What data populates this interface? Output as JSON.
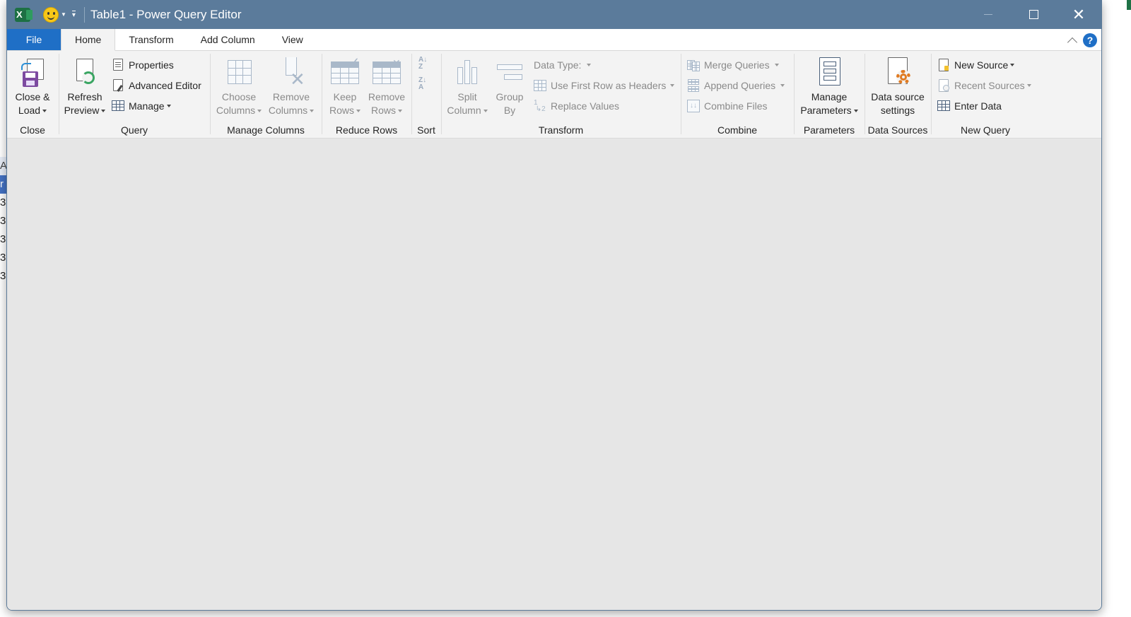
{
  "window": {
    "title": "Table1 - Power Query Editor"
  },
  "icons": {
    "app": "excel-icon",
    "feedback": "smiley-icon"
  },
  "background_peek": {
    "left_cells": [
      "A",
      "r",
      "3",
      "3",
      "3",
      "3",
      "3"
    ]
  },
  "tabs": [
    {
      "label": "File"
    },
    {
      "label": "Home"
    },
    {
      "label": "Transform"
    },
    {
      "label": "Add Column"
    },
    {
      "label": "View"
    }
  ],
  "active_tab": "Home",
  "ribbon": {
    "close": {
      "label": "Close",
      "close_load": {
        "line1": "Close &",
        "line2": "Load"
      }
    },
    "query": {
      "label": "Query",
      "refresh": {
        "line1": "Refresh",
        "line2": "Preview"
      },
      "properties": "Properties",
      "advanced_editor": "Advanced Editor",
      "manage": "Manage"
    },
    "manage_columns": {
      "label": "Manage Columns",
      "choose": {
        "line1": "Choose",
        "line2": "Columns"
      },
      "remove": {
        "line1": "Remove",
        "line2": "Columns"
      }
    },
    "reduce_rows": {
      "label": "Reduce Rows",
      "keep": {
        "line1": "Keep",
        "line2": "Rows"
      },
      "remove": {
        "line1": "Remove",
        "line2": "Rows"
      }
    },
    "sort": {
      "label": "Sort"
    },
    "transform": {
      "label": "Transform",
      "split": {
        "line1": "Split",
        "line2": "Column"
      },
      "group": {
        "line1": "Group",
        "line2": "By"
      },
      "data_type": "Data Type:",
      "first_row": "Use First Row as Headers",
      "replace": "Replace Values"
    },
    "combine": {
      "label": "Combine",
      "merge": "Merge Queries",
      "append": "Append Queries",
      "combine_files": "Combine Files"
    },
    "parameters": {
      "label": "Parameters",
      "manage": {
        "line1": "Manage",
        "line2": "Parameters"
      }
    },
    "data_sources": {
      "label": "Data Sources",
      "settings": {
        "line1": "Data source",
        "line2": "settings"
      }
    },
    "new_query": {
      "label": "New Query",
      "new_source": "New Source",
      "recent_sources": "Recent Sources",
      "enter_data": "Enter Data"
    }
  },
  "colors": {
    "titlebar": "#5b7b9b",
    "file_tab": "#1f6fc6",
    "ribbon_bg": "#f3f3f3",
    "content_bg": "#e6e6e6"
  }
}
